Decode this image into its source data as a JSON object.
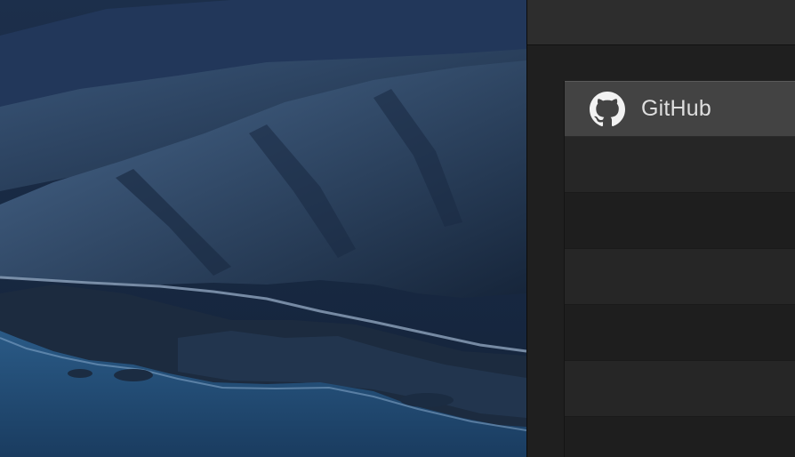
{
  "wallpaper": {
    "scene": "coastal-mountains-dusk"
  },
  "window": {
    "list": {
      "items": [
        {
          "label": "GitHub",
          "icon": "github-icon",
          "selected": true
        },
        {
          "label": "",
          "selected": false
        },
        {
          "label": "",
          "selected": false
        },
        {
          "label": "",
          "selected": false
        },
        {
          "label": "",
          "selected": false
        },
        {
          "label": "",
          "selected": false
        },
        {
          "label": "",
          "selected": false
        }
      ]
    }
  },
  "colors": {
    "titlebar": "#2d2d2d",
    "window_bg": "#1f1f1f",
    "row_selected": "#434343",
    "row_light": "#262626",
    "row_dark": "#1e1e1e",
    "text": "#dedede",
    "sea": "#1f4a73"
  }
}
